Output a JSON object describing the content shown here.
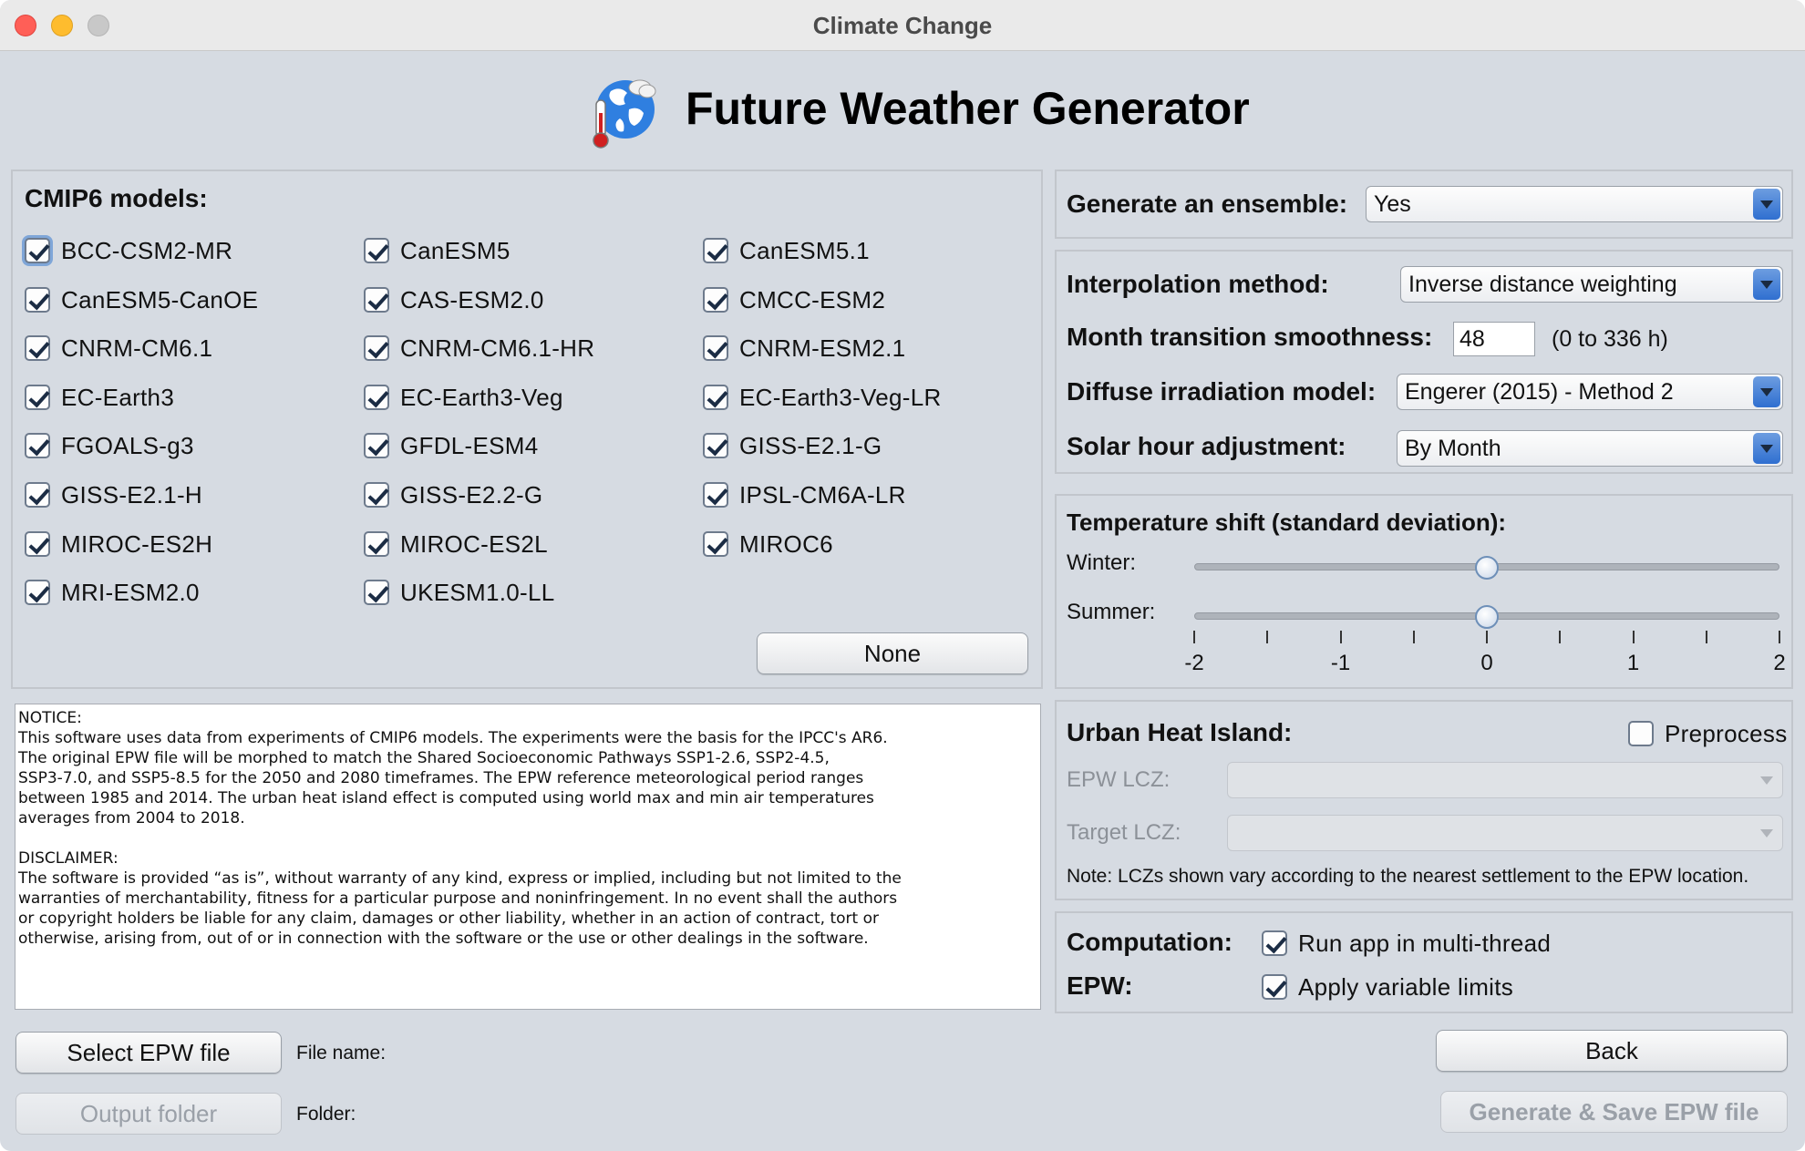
{
  "window": {
    "title": "Climate Change"
  },
  "header": {
    "title": "Future Weather Generator"
  },
  "models": {
    "title": "CMIP6 models:",
    "items": [
      {
        "label": "BCC-CSM2-MR",
        "checked": true
      },
      {
        "label": "CanESM5",
        "checked": true
      },
      {
        "label": "CanESM5.1",
        "checked": true
      },
      {
        "label": "CanESM5-CanOE",
        "checked": true
      },
      {
        "label": "CAS-ESM2.0",
        "checked": true
      },
      {
        "label": "CMCC-ESM2",
        "checked": true
      },
      {
        "label": "CNRM-CM6.1",
        "checked": true
      },
      {
        "label": "CNRM-CM6.1-HR",
        "checked": true
      },
      {
        "label": "CNRM-ESM2.1",
        "checked": true
      },
      {
        "label": "EC-Earth3",
        "checked": true
      },
      {
        "label": "EC-Earth3-Veg",
        "checked": true
      },
      {
        "label": "EC-Earth3-Veg-LR",
        "checked": true
      },
      {
        "label": "FGOALS-g3",
        "checked": true
      },
      {
        "label": "GFDL-ESM4",
        "checked": true
      },
      {
        "label": "GISS-E2.1-G",
        "checked": true
      },
      {
        "label": "GISS-E2.1-H",
        "checked": true
      },
      {
        "label": "GISS-E2.2-G",
        "checked": true
      },
      {
        "label": "IPSL-CM6A-LR",
        "checked": true
      },
      {
        "label": "MIROC-ES2H",
        "checked": true
      },
      {
        "label": "MIROC-ES2L",
        "checked": true
      },
      {
        "label": "MIROC6",
        "checked": true
      },
      {
        "label": "MRI-ESM2.0",
        "checked": true
      },
      {
        "label": "UKESM1.0-LL",
        "checked": true
      }
    ],
    "none_button": "None"
  },
  "notice": {
    "heading": "NOTICE:",
    "body": "This software uses data from experiments of CMIP6 models. The experiments were the basis for the IPCC's AR6.\nThe original EPW file will be morphed to match the Shared Socioeconomic Pathways SSP1-2.6, SSP2-4.5,\nSSP3-7.0, and SSP5-8.5 for the 2050 and 2080 timeframes. The EPW reference meteorological period ranges\nbetween 1985 and 2014. The urban heat island effect is computed using world max and min air temperatures\naverages from 2004 to 2018.",
    "disclaimer_heading": "DISCLAIMER:",
    "disclaimer_body": "The software is provided “as is”, without warranty of any kind, express or implied, including but not limited to the\nwarranties of merchantability, fitness for a particular purpose and noninfringement. In no event shall the authors\nor copyright holders be liable for any claim, damages or other liability, whether in an action of contract, tort or\notherwise, arising from, out of or in connection with the software or the use or other dealings in the software."
  },
  "file": {
    "select_button": "Select EPW file",
    "file_name_label": "File name:",
    "output_button": "Output folder",
    "folder_label": "Folder:"
  },
  "ensemble": {
    "label": "Generate an ensemble:",
    "value": "Yes"
  },
  "settings": {
    "interp_label": "Interpolation method:",
    "interp_value": "Inverse distance weighting",
    "smooth_label": "Month transition smoothness:",
    "smooth_value": "48",
    "smooth_range": "(0 to 336 h)",
    "diffuse_label": "Diffuse irradiation model:",
    "diffuse_value": "Engerer (2015) - Method 2",
    "solar_label": "Solar hour adjustment:",
    "solar_value": "By Month"
  },
  "temperature": {
    "title": "Temperature shift (standard deviation):",
    "winter_label": "Winter:",
    "summer_label": "Summer:",
    "winter_value": 0,
    "summer_value": 0,
    "min": -2,
    "max": 2,
    "tick_labels": [
      "-2",
      "-1",
      "0",
      "1",
      "2"
    ]
  },
  "uhi": {
    "title": "Urban Heat Island:",
    "preprocess_label": "Preprocess",
    "preprocess_checked": false,
    "epw_lcz_label": "EPW LCZ:",
    "target_lcz_label": "Target LCZ:",
    "note": "Note: LCZs shown vary according to the nearest settlement to the EPW location."
  },
  "computation": {
    "label": "Computation:",
    "multithread_label": "Run app in multi-thread",
    "epw_label": "EPW:",
    "limits_label": "Apply variable limits"
  },
  "actions": {
    "back": "Back",
    "generate": "Generate & Save EPW file"
  }
}
